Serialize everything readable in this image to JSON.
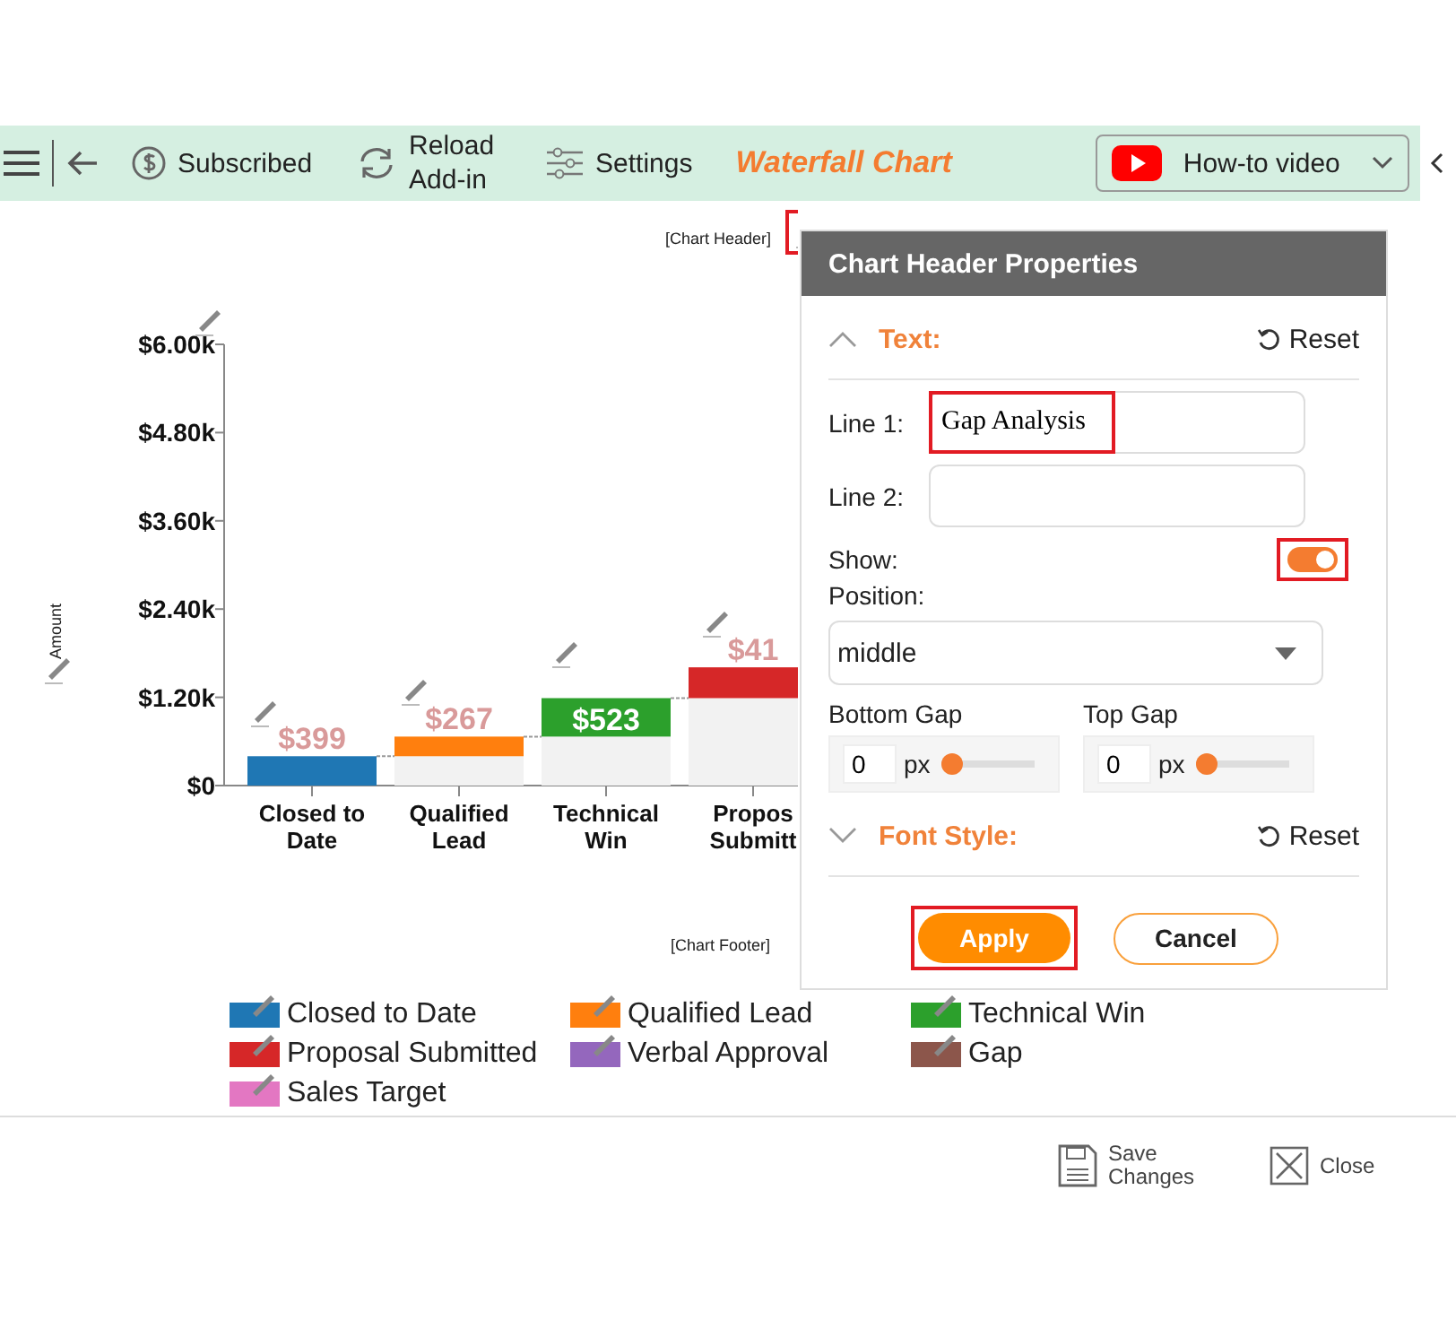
{
  "toolbar": {
    "subscribed": "Subscribed",
    "reload": "Reload Add-in",
    "settings": "Settings",
    "title": "Waterfall Chart",
    "video": "How-to video"
  },
  "chart": {
    "header": {
      "label": "[Chart Header]",
      "highlighted": true
    },
    "footer": "[Chart Footer]",
    "chart_data": {
      "type": "bar",
      "stacked": true,
      "ylabel": "Amount",
      "categories": [
        "Closed to Date",
        "Qualified Lead",
        "Technical Win",
        "Propos Submitt"
      ],
      "series": [
        {
          "color": "#f2f2f2",
          "values": [
            0,
            399,
            666,
            1189
          ]
        },
        {
          "name": "Closed to Date",
          "color": "#1f77b4",
          "values": [
            399,
            null,
            null,
            null
          ]
        },
        {
          "name": "Qualified Lead",
          "color": "#ff7f0e",
          "values": [
            null,
            267,
            null,
            null
          ]
        },
        {
          "name": "Technical Win",
          "color": "#2ca02c",
          "values": [
            null,
            null,
            523,
            null
          ]
        },
        {
          "name": "Proposal Submitted",
          "color": "#d62728",
          "values": [
            null,
            null,
            null,
            419
          ]
        },
        {
          "name": "Verbal Approval",
          "color": "#9467bd",
          "values": [
            null,
            null,
            null,
            null
          ]
        },
        {
          "name": "Gap",
          "color": "#8c564b",
          "values": [
            null,
            null,
            null,
            null
          ]
        },
        {
          "name": "Sales Target",
          "color": "#e377c2",
          "values": [
            null,
            null,
            null,
            null
          ]
        }
      ],
      "ylim": [
        0,
        6000
      ],
      "yticks": [
        {
          "value": 0,
          "label": "$0"
        },
        {
          "value": 1200,
          "label": "$1.20k"
        },
        {
          "value": 2400,
          "label": "$2.40k"
        },
        {
          "value": 3600,
          "label": "$3.60k"
        },
        {
          "value": 4800,
          "label": "$4.80k"
        },
        {
          "value": 6000,
          "label": "$6.00k"
        }
      ],
      "value_labels": [
        "$399",
        "$267",
        "$523",
        "$41"
      ]
    }
  },
  "panel": {
    "title": "Chart Header Properties",
    "sections": [
      {
        "title": "Text:",
        "expanded": true,
        "reset": "Reset"
      },
      {
        "title": "Font Style:",
        "expanded": false,
        "reset": "Reset"
      }
    ],
    "line1": {
      "label": "Line 1:",
      "value": "Gap Analysis",
      "highlighted": true
    },
    "line2": {
      "label": "Line 2:"
    },
    "show": {
      "label": "Show:",
      "on": true,
      "highlighted": true
    },
    "position": {
      "label": "Position:",
      "value": "middle"
    },
    "gaps": [
      {
        "label": "Bottom Gap",
        "value": "0",
        "unit": "px",
        "level": 0
      },
      {
        "label": "Top Gap",
        "value": "0",
        "unit": "px",
        "level": 0
      }
    ],
    "apply": {
      "label": "Apply",
      "highlighted": true
    },
    "cancel": "Cancel"
  },
  "footer": {
    "save": "Save Changes",
    "close": "Close"
  }
}
